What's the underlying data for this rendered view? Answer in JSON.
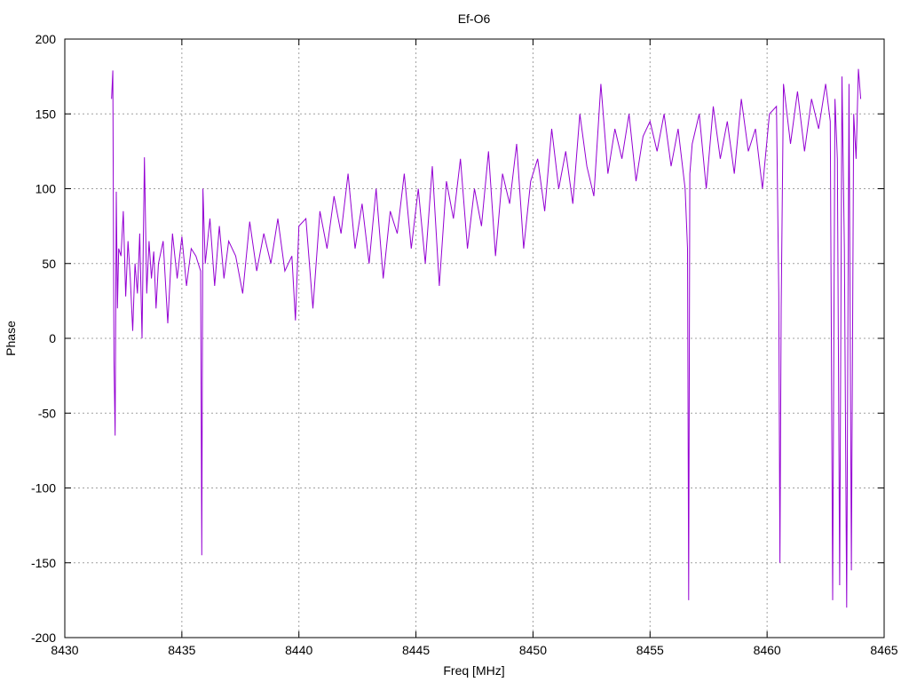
{
  "chart_data": {
    "type": "line",
    "title": "Ef-O6",
    "xlabel": "Freq [MHz]",
    "ylabel": "Phase",
    "xlim": [
      8430,
      8465
    ],
    "ylim": [
      -200,
      200
    ],
    "x_ticks": [
      8430,
      8435,
      8440,
      8445,
      8450,
      8455,
      8460,
      8465
    ],
    "y_ticks": [
      -200,
      -150,
      -100,
      -50,
      0,
      50,
      100,
      150,
      200
    ],
    "grid": true,
    "legend": "none",
    "series": [
      {
        "color": "#9400d3",
        "x": [
          8432.0,
          8432.05,
          8432.1,
          8432.15,
          8432.2,
          8432.25,
          8432.3,
          8432.4,
          8432.5,
          8432.6,
          8432.7,
          8432.8,
          8432.9,
          8433.0,
          8433.1,
          8433.2,
          8433.3,
          8433.4,
          8433.5,
          8433.6,
          8433.7,
          8433.8,
          8433.9,
          8434.0,
          8434.2,
          8434.4,
          8434.6,
          8434.8,
          8435.0,
          8435.2,
          8435.4,
          8435.6,
          8435.8,
          8435.85,
          8435.9,
          8436.0,
          8436.2,
          8436.4,
          8436.6,
          8436.8,
          8437.0,
          8437.3,
          8437.6,
          8437.9,
          8438.2,
          8438.5,
          8438.8,
          8439.1,
          8439.4,
          8439.7,
          8439.85,
          8440.0,
          8440.3,
          8440.6,
          8440.9,
          8441.2,
          8441.5,
          8441.8,
          8442.1,
          8442.4,
          8442.7,
          8443.0,
          8443.3,
          8443.6,
          8443.9,
          8444.2,
          8444.5,
          8444.8,
          8445.1,
          8445.4,
          8445.7,
          8446.0,
          8446.3,
          8446.6,
          8446.9,
          8447.2,
          8447.5,
          8447.8,
          8448.1,
          8448.4,
          8448.7,
          8449.0,
          8449.3,
          8449.6,
          8449.9,
          8450.2,
          8450.5,
          8450.8,
          8451.1,
          8451.4,
          8451.7,
          8452.0,
          8452.3,
          8452.6,
          8452.9,
          8453.2,
          8453.5,
          8453.8,
          8454.1,
          8454.4,
          8454.7,
          8455.0,
          8455.3,
          8455.6,
          8455.9,
          8456.2,
          8456.5,
          8456.6,
          8456.65,
          8456.7,
          8456.8,
          8457.1,
          8457.4,
          8457.7,
          8458.0,
          8458.3,
          8458.6,
          8458.9,
          8459.2,
          8459.5,
          8459.8,
          8460.1,
          8460.4,
          8460.5,
          8460.55,
          8460.6,
          8460.7,
          8461.0,
          8461.3,
          8461.6,
          8461.9,
          8462.2,
          8462.5,
          8462.7,
          8462.8,
          8462.9,
          8463.0,
          8463.1,
          8463.2,
          8463.3,
          8463.4,
          8463.5,
          8463.6,
          8463.7,
          8463.8,
          8463.9,
          8464.0
        ],
        "y": [
          160,
          179,
          -15,
          -65,
          98,
          20,
          60,
          55,
          85,
          28,
          65,
          40,
          5,
          50,
          30,
          70,
          0,
          121,
          30,
          65,
          40,
          58,
          20,
          50,
          65,
          10,
          70,
          40,
          68,
          35,
          60,
          55,
          45,
          -145,
          100,
          50,
          80,
          35,
          75,
          40,
          65,
          55,
          30,
          78,
          45,
          70,
          50,
          80,
          45,
          55,
          12,
          75,
          80,
          20,
          85,
          60,
          95,
          70,
          110,
          60,
          90,
          50,
          100,
          40,
          85,
          70,
          110,
          60,
          100,
          50,
          115,
          35,
          105,
          80,
          120,
          60,
          100,
          75,
          125,
          55,
          110,
          90,
          130,
          60,
          105,
          120,
          85,
          140,
          100,
          125,
          90,
          150,
          115,
          95,
          170,
          110,
          140,
          120,
          150,
          105,
          135,
          145,
          125,
          150,
          115,
          140,
          100,
          60,
          -175,
          110,
          130,
          150,
          100,
          155,
          120,
          145,
          110,
          160,
          125,
          140,
          100,
          150,
          155,
          30,
          -150,
          20,
          170,
          130,
          165,
          125,
          160,
          140,
          170,
          145,
          -175,
          160,
          120,
          -165,
          175,
          60,
          -180,
          170,
          -155,
          150,
          120,
          180,
          160
        ]
      }
    ]
  }
}
